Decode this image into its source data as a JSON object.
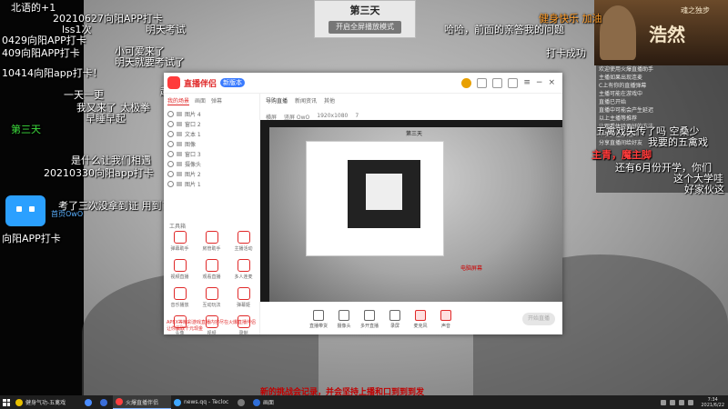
{
  "stream": {
    "top_card_title": "第三天",
    "top_card_button": "开启全屏播放模式",
    "poster_title": "浩然",
    "poster_sub": "魂之独步",
    "bottom_banner": "新的挑战会记录，并会坚持上播和口到到到发"
  },
  "danmaku": [
    {
      "text": "北语的+1",
      "cls": "w"
    },
    {
      "text": "20210627向阳APP打卡",
      "cls": "w"
    },
    {
      "text": "lss1次",
      "cls": "w"
    },
    {
      "text": "0429向阳APP打卡",
      "cls": "w"
    },
    {
      "text": "409向阳APP打卡",
      "cls": "w"
    },
    {
      "text": "10414向阳app打卡！",
      "cls": "w"
    },
    {
      "text": "一天一更",
      "cls": "w"
    },
    {
      "text": "我又来了",
      "cls": "w"
    },
    {
      "text": "早睡早起",
      "cls": "w"
    },
    {
      "text": "第三天",
      "cls": "g"
    },
    {
      "text": "是什么让我们相遇",
      "cls": "w"
    },
    {
      "text": "20210330向阳app打卡",
      "cls": "w"
    },
    {
      "text": "考了三次没拿到证 用到了",
      "cls": "w"
    },
    {
      "text": "首页OwO",
      "cls": "w"
    },
    {
      "text": "向阳APP打卡",
      "cls": "w"
    },
    {
      "text": "哈哈，前面的亲答我的问题",
      "cls": "w"
    },
    {
      "text": "健身快乐 加油",
      "cls": "o"
    },
    {
      "text": "打卡成功",
      "cls": "w"
    },
    {
      "text": "明天考试",
      "cls": "w"
    },
    {
      "text": "小可爱来了",
      "cls": "w"
    },
    {
      "text": "明天就要考试了",
      "cls": "w"
    },
    {
      "text": "主青，魔主脚",
      "cls": "r"
    },
    {
      "text": "我要的五禽戏",
      "cls": "w"
    },
    {
      "text": "还有6月份开学，你们",
      "cls": "w"
    },
    {
      "text": "这个大学哇",
      "cls": "w"
    },
    {
      "text": "好家伙这",
      "cls": "w"
    },
    {
      "text": "太极拳",
      "cls": "w"
    },
    {
      "text": "五禽戏失传了吗 空桑少",
      "cls": "w"
    },
    {
      "text": "起脸",
      "cls": "w"
    }
  ],
  "chat_lines": [
    "欢迎使用火爆直播助手",
    "主播如果出现连麦",
    "C上有你的直播弹幕",
    "主播可能在游戏中",
    "直播已开始",
    "直播中可能会产生延迟",
    "以上主播等推荐",
    "",
    "让观看体验更好的方法",
    "点赞关注直播间",
    "分享直播间给好友"
  ],
  "app": {
    "brand": "直播伴侣",
    "brand_badge": "新版本",
    "sidebar_tabs": [
      "我的场景",
      "画面",
      "弹幕"
    ],
    "scenes": [
      "图片 4",
      "窗口 2",
      "文本 1",
      "图像",
      "窗口 3",
      "摄像头",
      "图片 2",
      "图片 1"
    ],
    "tools_label": "工具箱",
    "tools": [
      "弹幕助手",
      "房管助手",
      "主播活动",
      "视频直播",
      "观看直播",
      "多人连麦",
      "音乐播放",
      "互动玩法",
      "弹幕姬",
      "头像",
      "视频",
      "录制"
    ],
    "notice": "APEX等精彩游戏直播内容尽在火爆直播伴侣 让你赢取千元现金",
    "main_tabs": [
      "导购直播",
      "新闻资讯",
      "其他"
    ],
    "info": [
      "横屏",
      "竖屏 OwO",
      "1920x1080",
      "7"
    ],
    "preview_labels": {
      "day": "第三天",
      "screen": "电脑屏幕"
    },
    "toolbar": [
      "直播带货",
      "摄像头",
      "多开直播",
      "录屏",
      "麦克风",
      "声音"
    ],
    "start_button": "开始直播"
  },
  "taskbar": {
    "items": [
      {
        "label": "健身气功-五禽戏",
        "color": "#e8c000"
      },
      {
        "label": "",
        "color": "#4a8cff"
      },
      {
        "label": "",
        "color": "#3b6ed8"
      },
      {
        "label": "火爆直播伴侣",
        "color": "#ff4040",
        "active": true
      },
      {
        "label": "news.qq - Tecloc",
        "color": "#3fa7ff"
      },
      {
        "label": "",
        "color": "#7a7a7a"
      },
      {
        "label": "画面",
        "color": "#2f6ed8"
      }
    ],
    "time": "7:34",
    "date": "2021/6/22"
  }
}
